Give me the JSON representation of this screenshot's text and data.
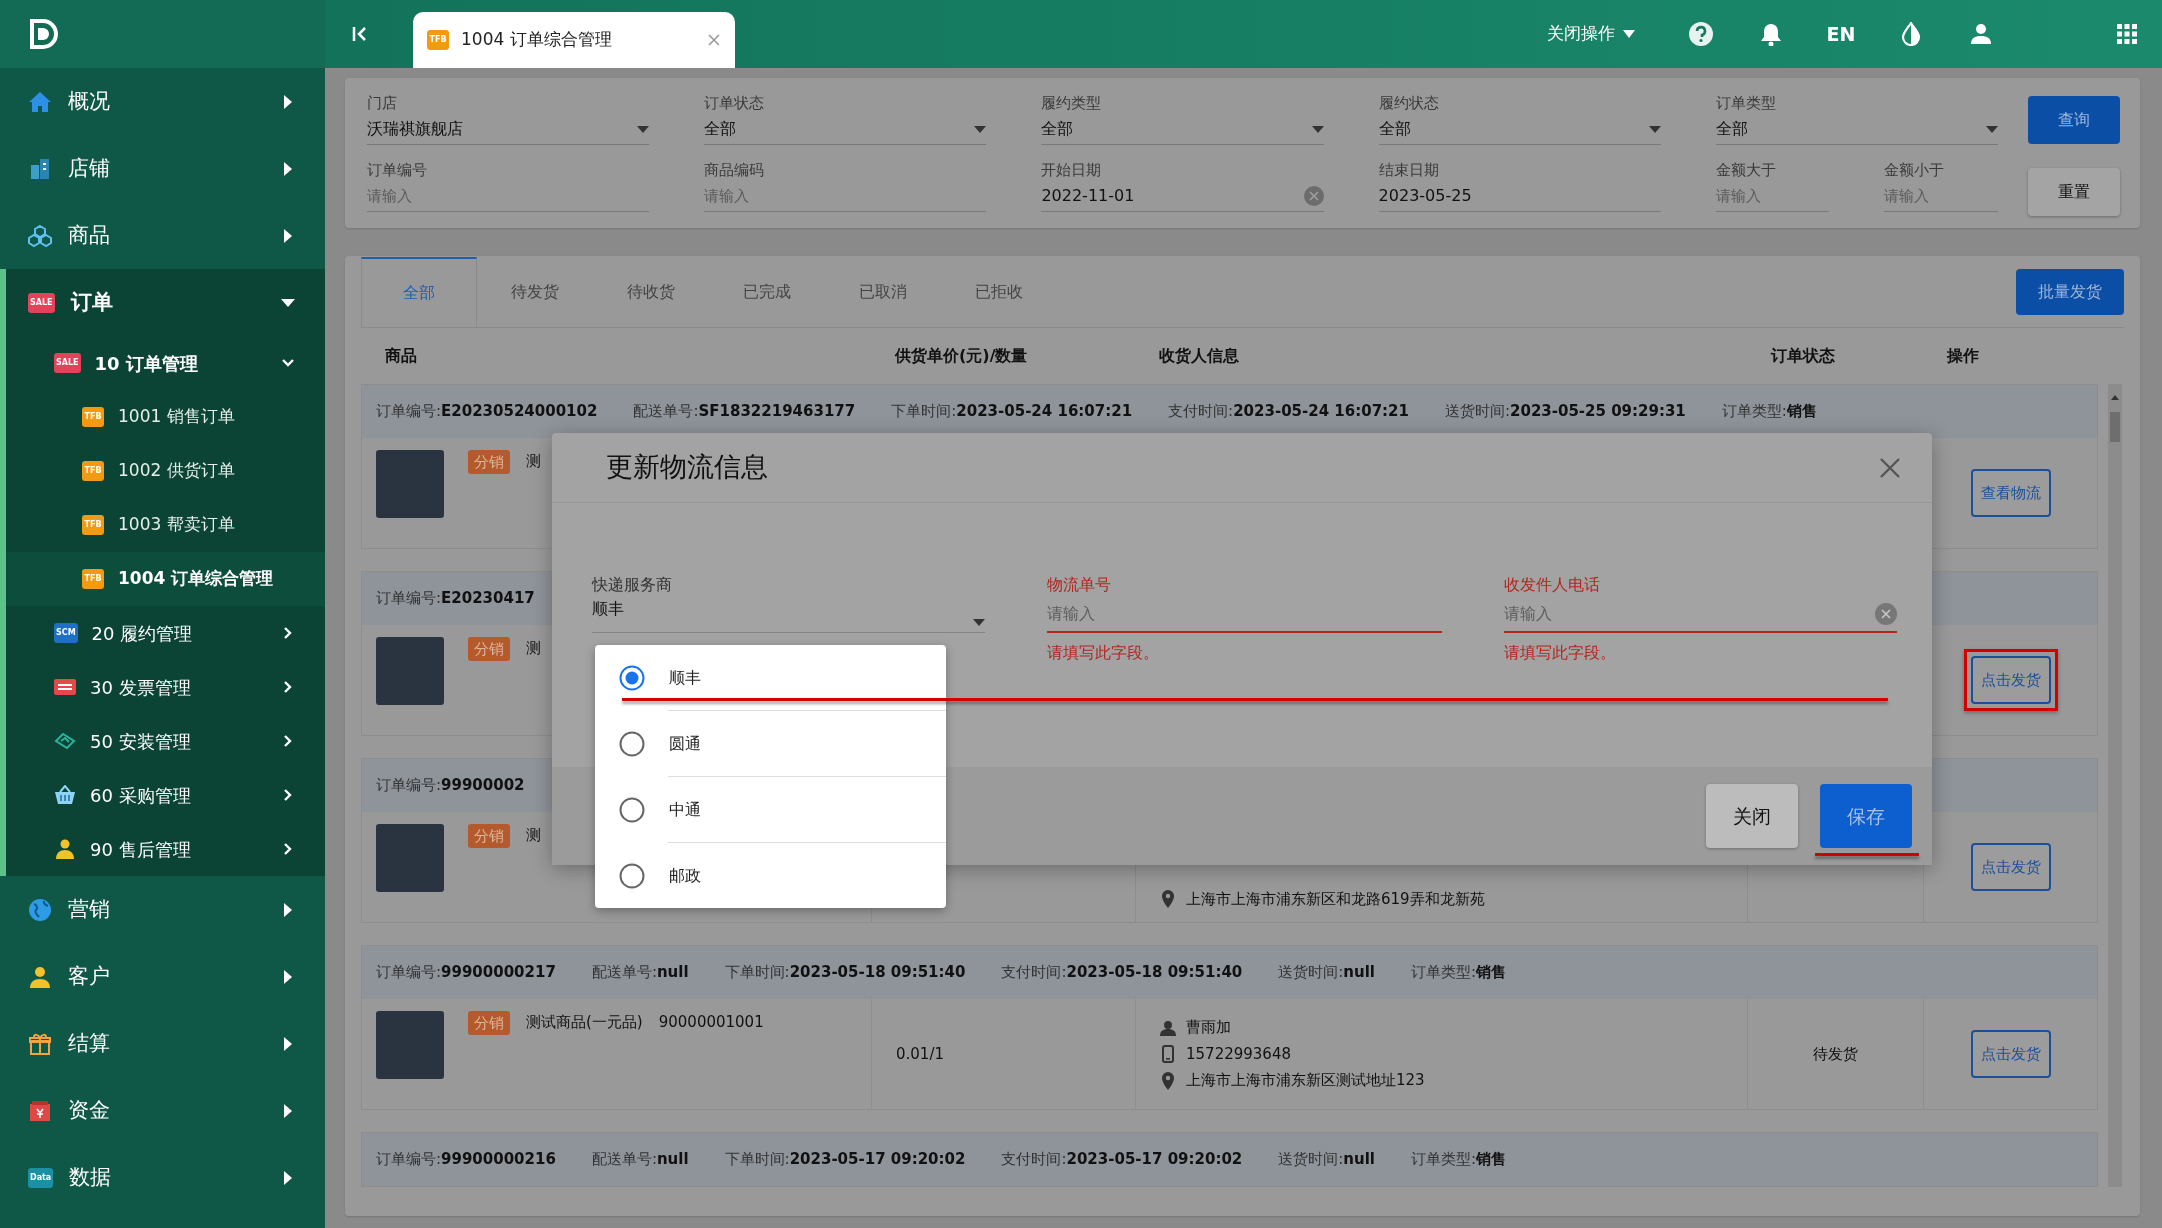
{
  "topbar": {
    "tab": {
      "badge": "TFB",
      "label": "1004 订单综合管理"
    },
    "ops": "关闭操作",
    "lang": "EN"
  },
  "sidebar": {
    "items": [
      {
        "label": "概况",
        "expanded": false
      },
      {
        "label": "店铺",
        "expanded": false
      },
      {
        "label": "商品",
        "expanded": false
      },
      {
        "label": "订单",
        "expanded": true,
        "badge": "SALE",
        "color": "#e0435a",
        "children": [
          {
            "label": "10 订单管理",
            "expanded": true,
            "badge": "SALE",
            "color": "#e0435a",
            "children": [
              {
                "label": "1001 销售订单",
                "badge": "TFB",
                "color": "#f29a12",
                "selected": false
              },
              {
                "label": "1002 供货订单",
                "badge": "TFB",
                "color": "#f29a12",
                "selected": false
              },
              {
                "label": "1003 帮卖订单",
                "badge": "TFB",
                "color": "#f29a12",
                "selected": false
              },
              {
                "label": "1004 订单综合管理",
                "badge": "TFB",
                "color": "#f29a12",
                "selected": true
              }
            ]
          },
          {
            "label": "20 履约管理",
            "expanded": false,
            "badge": "SCM",
            "color": "#1f6fc4"
          },
          {
            "label": "30 发票管理",
            "expanded": false
          },
          {
            "label": "50 安装管理",
            "expanded": false
          },
          {
            "label": "60 采购管理",
            "expanded": false
          },
          {
            "label": "90 售后管理",
            "expanded": false
          }
        ]
      },
      {
        "label": "营销",
        "expanded": false
      },
      {
        "label": "客户",
        "expanded": false
      },
      {
        "label": "结算",
        "expanded": false
      },
      {
        "label": "资金",
        "expanded": false
      },
      {
        "label": "数据",
        "expanded": false,
        "badge": "Data",
        "color": "#1b8fa3"
      }
    ]
  },
  "filters": {
    "fields": [
      {
        "label": "门店",
        "value": "沃瑞祺旗舰店",
        "kind": "select"
      },
      {
        "label": "订单状态",
        "value": "全部",
        "kind": "select"
      },
      {
        "label": "履约类型",
        "value": "全部",
        "kind": "select"
      },
      {
        "label": "履约状态",
        "value": "全部",
        "kind": "select"
      },
      {
        "label": "订单类型",
        "value": "全部",
        "kind": "select"
      },
      {
        "label": "订单编号",
        "placeholder": "请输入",
        "kind": "input"
      },
      {
        "label": "商品编码",
        "placeholder": "请输入",
        "kind": "input"
      },
      {
        "label": "开始日期",
        "value": "2022-11-01",
        "kind": "input",
        "clearable": true
      },
      {
        "label": "结束日期",
        "value": "2023-05-25",
        "kind": "input"
      },
      {
        "label": "金额大于",
        "placeholder": "请输入",
        "kind": "input"
      },
      {
        "label": "金额小于",
        "placeholder": "请输入",
        "kind": "input"
      }
    ],
    "search_button": "查询",
    "reset_button": "重置"
  },
  "tabs": [
    {
      "label": "全部",
      "selected": true
    },
    {
      "label": "待发货",
      "selected": false
    },
    {
      "label": "待收货",
      "selected": false
    },
    {
      "label": "已完成",
      "selected": false
    },
    {
      "label": "已取消",
      "selected": false
    },
    {
      "label": "已拒收",
      "selected": false
    }
  ],
  "batch_button": "批量发货",
  "table": {
    "columns": [
      "商品",
      "供货单价(元)/数量",
      "收货人信息",
      "订单状态",
      "操作"
    ],
    "rows": [
      {
        "header": [
          {
            "label": "订单编号:",
            "value": "E20230524000102"
          },
          {
            "label": "配送单号:",
            "value": "SF1832219463177"
          },
          {
            "label": "下单时间:",
            "value": "2023-05-24 16:07:21"
          },
          {
            "label": "支付时间:",
            "value": "2023-05-24 16:07:21"
          },
          {
            "label": "送货时间:",
            "value": "2023-05-25 09:29:31"
          },
          {
            "label": "订单类型:",
            "value": "销售"
          }
        ],
        "tag": "分销",
        "product": "测",
        "action": "查看物流",
        "marked": false
      },
      {
        "header": [
          {
            "label": "订单编号:",
            "value": "E20230417"
          }
        ],
        "tag": "分销",
        "product": "测",
        "action": "点击发货",
        "marked": true
      },
      {
        "header": [
          {
            "label": "订单编号:",
            "value": "99900002"
          }
        ],
        "tag": "分销",
        "product": "测",
        "address": "上海市上海市浦东新区和龙路619弄和龙新苑",
        "action": "点击发货",
        "marked": false
      },
      {
        "header": [
          {
            "label": "订单编号:",
            "value": "99900000217"
          },
          {
            "label": "配送单号:",
            "value": "null"
          },
          {
            "label": "下单时间:",
            "value": "2023-05-18 09:51:40"
          },
          {
            "label": "支付时间:",
            "value": "2023-05-18 09:51:40"
          },
          {
            "label": "送货时间:",
            "value": "null"
          },
          {
            "label": "订单类型:",
            "value": "销售"
          }
        ],
        "tag": "分销",
        "product": "测试商品(一元品)",
        "code": "90000001001",
        "price": "0.01/1",
        "name": "曹雨加",
        "phone": "15722993648",
        "address": "上海市上海市浦东新区测试地址123",
        "status": "待发货",
        "action": "点击发货",
        "marked": false
      },
      {
        "header": [
          {
            "label": "订单编号:",
            "value": "99900000216"
          },
          {
            "label": "配送单号:",
            "value": "null"
          },
          {
            "label": "下单时间:",
            "value": "2023-05-17 09:20:02"
          },
          {
            "label": "支付时间:",
            "value": "2023-05-17 09:20:02"
          },
          {
            "label": "送货时间:",
            "value": "null"
          },
          {
            "label": "订单类型:",
            "value": "销售"
          }
        ]
      }
    ]
  },
  "modal": {
    "title": "更新物流信息",
    "fields": [
      {
        "label": "快递服务商",
        "value": "顺丰",
        "kind": "select"
      },
      {
        "label": "物流单号",
        "placeholder": "请输入",
        "kind": "input",
        "error": "请填写此字段。"
      },
      {
        "label": "收发件人电话",
        "placeholder": "请输入",
        "kind": "input",
        "error": "请填写此字段。",
        "clearable": true
      }
    ],
    "options": [
      {
        "label": "顺丰",
        "selected": true
      },
      {
        "label": "圆通",
        "selected": false
      },
      {
        "label": "中通",
        "selected": false
      },
      {
        "label": "邮政",
        "selected": false
      }
    ],
    "fields_marked": true,
    "close_button": "关闭",
    "save_button": "保存",
    "save_marked": true
  }
}
